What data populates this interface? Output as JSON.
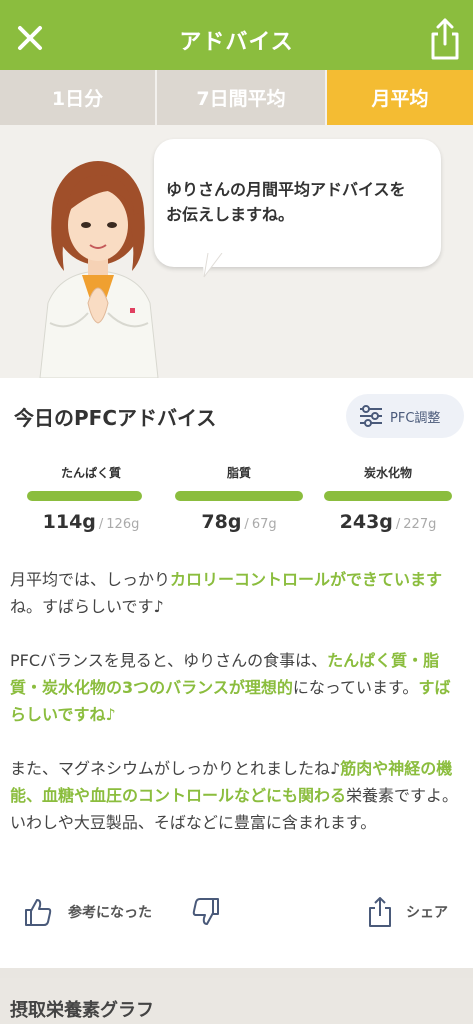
{
  "header": {
    "title": "アドバイス",
    "close_icon": "close-icon",
    "share_icon": "share-icon",
    "accent_color": "#8bbd3e"
  },
  "tabs": [
    {
      "label": "1日分",
      "active": false
    },
    {
      "label": "7日間平均",
      "active": false
    },
    {
      "label": "月平均",
      "active": true
    }
  ],
  "bubble": {
    "line1": "ゆりさんの月間平均アドバイスを",
    "line2": "お伝えしますね。"
  },
  "advice_card": {
    "title": "今日のPFCアドバイス",
    "pfc_button": "PFC調整",
    "nutrients": [
      {
        "name": "たんぱく質",
        "value": "114g",
        "target": "126g",
        "fill": 0.9
      },
      {
        "name": "脂質",
        "value": "78g",
        "target": "67g",
        "fill": 1.0
      },
      {
        "name": "炭水化物",
        "value": "243g",
        "target": "227g",
        "fill": 1.0
      }
    ],
    "paragraphs": {
      "p1_a": "月平均では、しっかり",
      "p1_hl": "カロリーコントロールができています",
      "p1_b": "ね。すばらしいです♪",
      "p2_a": "PFCバランスを見ると、ゆりさんの食事は、",
      "p2_hl": "たんぱく質・脂質・炭水化物の3つのバランスが理想的",
      "p2_b": "になっています。",
      "p2_hl2": "すばらしいですね♪",
      "p3_a": "また、マグネシウムがしっかりとれましたね♪",
      "p3_hl": "筋肉や神経の機能、血糖や血圧のコントロールなどにも関わる",
      "p3_b": "栄養素ですよ。いわしや大豆製品、そばなどに豊富に含まれます。"
    },
    "like_label": "参考になった",
    "share_label": "シェア"
  },
  "bottom_section": {
    "title": "摂取栄養素グラフ"
  }
}
